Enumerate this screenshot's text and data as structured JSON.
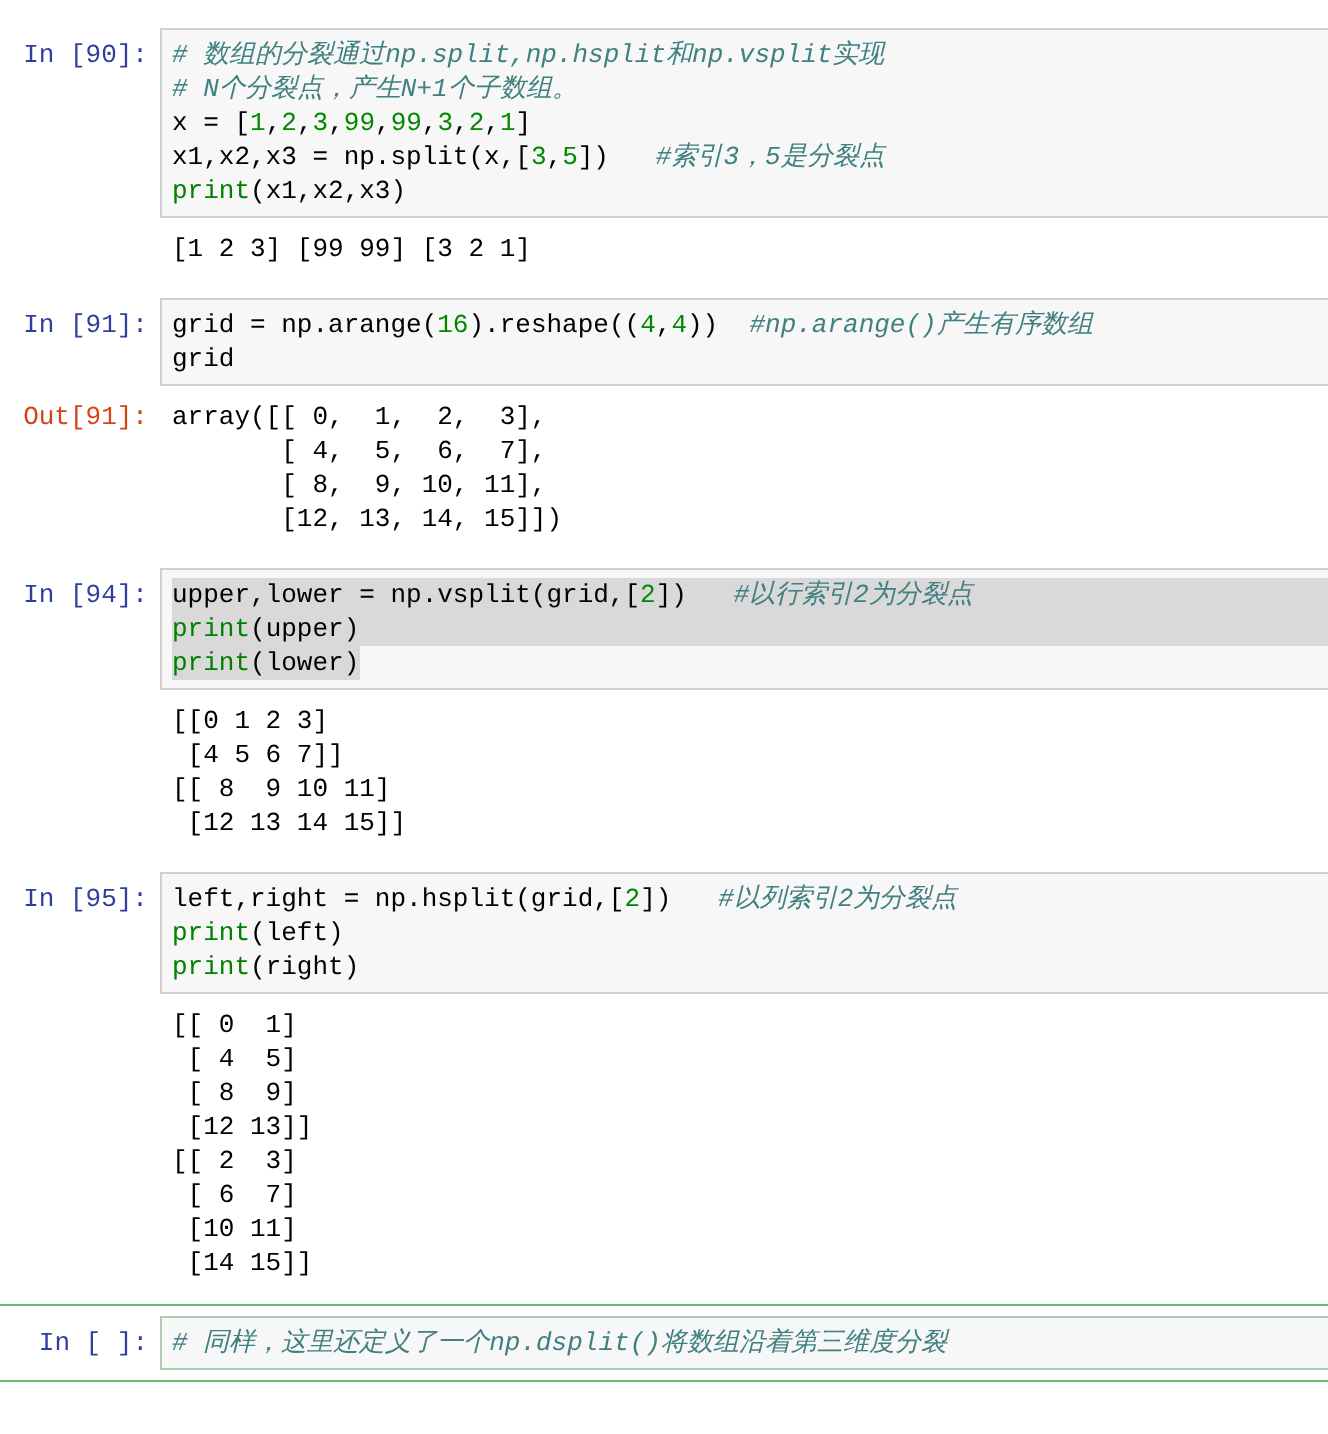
{
  "cells": [
    {
      "prompt": "In [90]:",
      "selected": false,
      "lines": [
        {
          "tokens": [
            {
              "kind": "comment",
              "text": "# 数组的分裂通过np.split,np.hsplit和np.vsplit实现"
            }
          ]
        },
        {
          "tokens": [
            {
              "kind": "comment",
              "text": "# N个分裂点，产生N+1个子数组。"
            }
          ]
        },
        {
          "tokens": [
            {
              "kind": "code",
              "text": "x = ["
            },
            {
              "kind": "num",
              "text": "1"
            },
            {
              "kind": "code",
              "text": ","
            },
            {
              "kind": "num",
              "text": "2"
            },
            {
              "kind": "code",
              "text": ","
            },
            {
              "kind": "num",
              "text": "3"
            },
            {
              "kind": "code",
              "text": ","
            },
            {
              "kind": "num",
              "text": "99"
            },
            {
              "kind": "code",
              "text": ","
            },
            {
              "kind": "num",
              "text": "99"
            },
            {
              "kind": "code",
              "text": ","
            },
            {
              "kind": "num",
              "text": "3"
            },
            {
              "kind": "code",
              "text": ","
            },
            {
              "kind": "num",
              "text": "2"
            },
            {
              "kind": "code",
              "text": ","
            },
            {
              "kind": "num",
              "text": "1"
            },
            {
              "kind": "code",
              "text": "]"
            }
          ]
        },
        {
          "tokens": [
            {
              "kind": "code",
              "text": "x1,x2,x3 = np.split(x,["
            },
            {
              "kind": "num",
              "text": "3"
            },
            {
              "kind": "code",
              "text": ","
            },
            {
              "kind": "num",
              "text": "5"
            },
            {
              "kind": "code",
              "text": "])   "
            },
            {
              "kind": "comment",
              "text": "#索引3，5是分裂点"
            }
          ]
        },
        {
          "tokens": [
            {
              "kind": "builtin",
              "text": "print"
            },
            {
              "kind": "code",
              "text": "(x1,x2,x3)"
            }
          ]
        }
      ],
      "output": [
        "[1 2 3] [99 99] [3 2 1]"
      ]
    },
    {
      "prompt": "In [91]:",
      "selected": false,
      "output_prompt": "Out[91]:",
      "lines": [
        {
          "tokens": [
            {
              "kind": "code",
              "text": "grid = np.arange("
            },
            {
              "kind": "num",
              "text": "16"
            },
            {
              "kind": "code",
              "text": ").reshape(("
            },
            {
              "kind": "num",
              "text": "4"
            },
            {
              "kind": "code",
              "text": ","
            },
            {
              "kind": "num",
              "text": "4"
            },
            {
              "kind": "code",
              "text": "))  "
            },
            {
              "kind": "comment",
              "text": "#np.arange()产生有序数组"
            }
          ]
        },
        {
          "tokens": [
            {
              "kind": "code",
              "text": "grid"
            }
          ]
        }
      ],
      "output": [
        "array([[ 0,  1,  2,  3],",
        "       [ 4,  5,  6,  7],",
        "       [ 8,  9, 10, 11],",
        "       [12, 13, 14, 15]])"
      ]
    },
    {
      "prompt": "In [94]:",
      "selected": false,
      "lines": [
        {
          "highlighted": true,
          "highlight_to_end": true,
          "tokens": [
            {
              "kind": "code",
              "text": "upper,lower = np.vsplit(grid,["
            },
            {
              "kind": "num",
              "text": "2"
            },
            {
              "kind": "code",
              "text": "])   "
            },
            {
              "kind": "comment",
              "text": "#以行索引2为分裂点"
            }
          ]
        },
        {
          "highlighted": true,
          "highlight_to_end": true,
          "tokens": [
            {
              "kind": "builtin",
              "text": "print"
            },
            {
              "kind": "code",
              "text": "(upper)"
            }
          ]
        },
        {
          "highlighted": true,
          "highlight_to_end": false,
          "tokens": [
            {
              "kind": "builtin",
              "text": "print"
            },
            {
              "kind": "code",
              "text": "(lower)"
            }
          ]
        }
      ],
      "output": [
        "[[0 1 2 3]",
        " [4 5 6 7]]",
        "[[ 8  9 10 11]",
        " [12 13 14 15]]"
      ]
    },
    {
      "prompt": "In [95]:",
      "selected": false,
      "lines": [
        {
          "tokens": [
            {
              "kind": "code",
              "text": "left,right = np.hsplit(grid,["
            },
            {
              "kind": "num",
              "text": "2"
            },
            {
              "kind": "code",
              "text": "])   "
            },
            {
              "kind": "comment",
              "text": "#以列索引2为分裂点"
            }
          ]
        },
        {
          "tokens": [
            {
              "kind": "builtin",
              "text": "print"
            },
            {
              "kind": "code",
              "text": "(left)"
            }
          ]
        },
        {
          "tokens": [
            {
              "kind": "builtin",
              "text": "print"
            },
            {
              "kind": "code",
              "text": "(right)"
            }
          ]
        }
      ],
      "output": [
        "[[ 0  1]",
        " [ 4  5]",
        " [ 8  9]",
        " [12 13]]",
        "[[ 2  3]",
        " [ 6  7]",
        " [10 11]",
        " [14 15]]"
      ]
    },
    {
      "prompt": "In [ ]:",
      "selected": true,
      "lines": [
        {
          "tokens": [
            {
              "kind": "comment",
              "text": "# 同样，这里还定义了一个np.dsplit()将数组沿着第三维度分裂"
            }
          ]
        }
      ]
    }
  ]
}
